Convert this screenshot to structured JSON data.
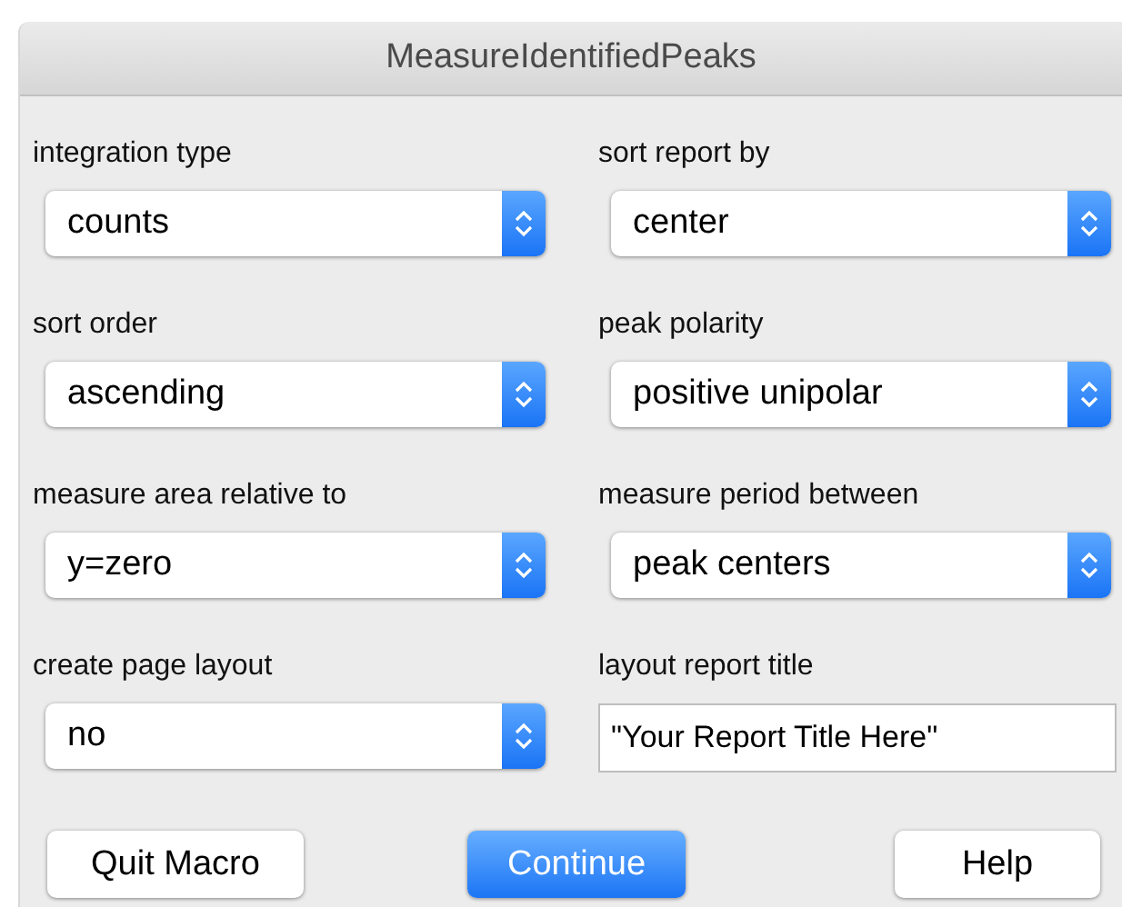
{
  "window": {
    "title": "MeasureIdentifiedPeaks"
  },
  "fields": [
    {
      "label": "integration type",
      "kind": "popup",
      "value": "counts"
    },
    {
      "label": "sort report by",
      "kind": "popup",
      "value": "center"
    },
    {
      "label": "sort order",
      "kind": "popup",
      "value": "ascending"
    },
    {
      "label": "peak polarity",
      "kind": "popup",
      "value": "positive unipolar"
    },
    {
      "label": "measure area relative to",
      "kind": "popup",
      "value": "y=zero"
    },
    {
      "label": "measure period between",
      "kind": "popup",
      "value": "peak centers"
    },
    {
      "label": "create page layout",
      "kind": "popup",
      "value": "no"
    },
    {
      "label": "layout report title",
      "kind": "text",
      "value": "\"Your Report Title Here\""
    }
  ],
  "buttons": [
    {
      "label": "Quit Macro",
      "kind": "normal"
    },
    {
      "label": "Continue",
      "kind": "default"
    },
    {
      "label": "Help",
      "kind": "normal"
    }
  ]
}
